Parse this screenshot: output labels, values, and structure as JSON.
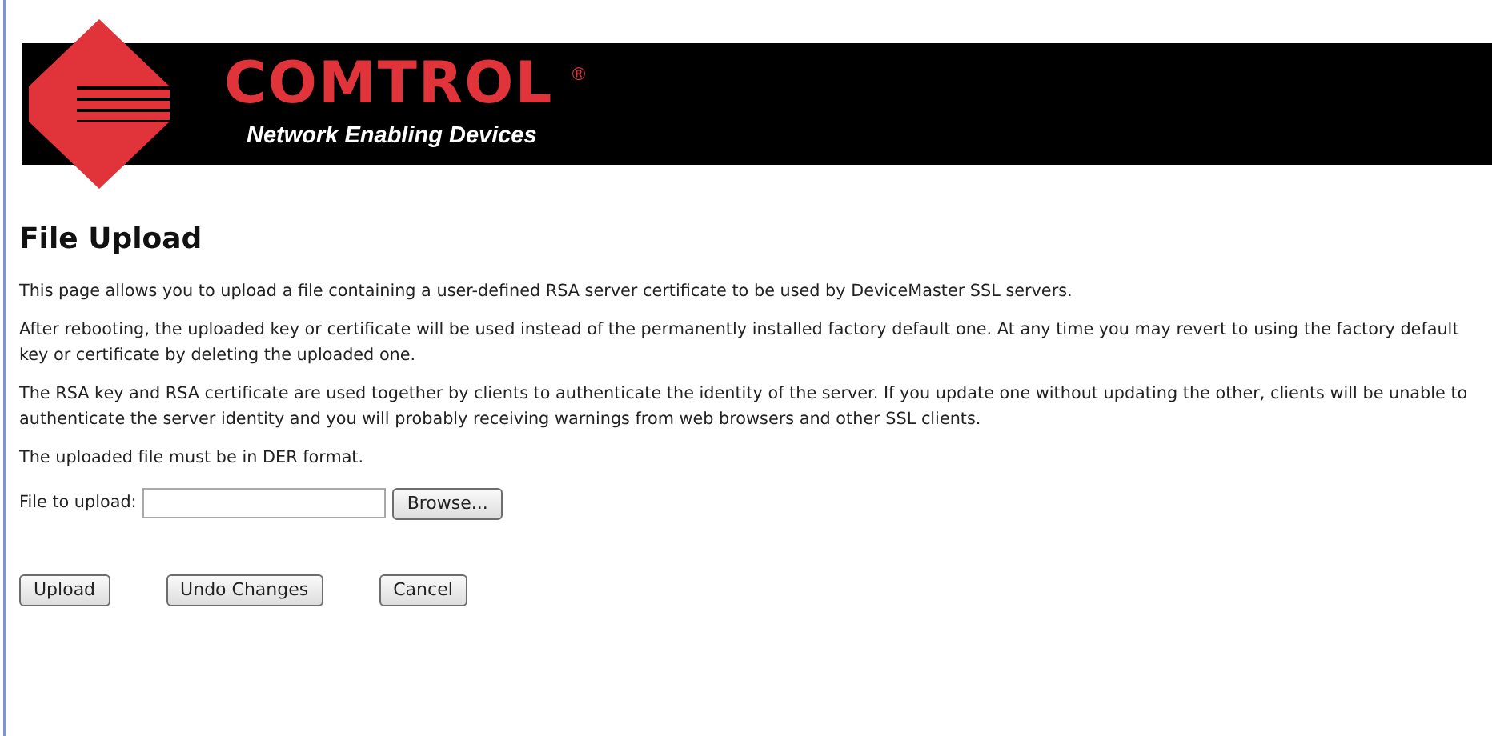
{
  "logo": {
    "brand": "COMTROL",
    "registered": "®",
    "tagline": "Network Enabling Devices"
  },
  "page_title": "File Upload",
  "paragraphs": [
    "This page allows you to upload a file containing a user-defined RSA server certificate to be used by DeviceMaster SSL servers.",
    "After rebooting, the uploaded key or certificate will be used instead of the permanently installed factory default one. At any time you may revert to using the factory default key or certificate by deleting the uploaded one.",
    "The RSA key and RSA certificate are used together by clients to authenticate the identity of the server. If you update one without updating the other, clients will be unable to authenticate the server identity and you will probably receiving warnings from web browsers and other SSL clients.",
    "The uploaded file must be in DER format."
  ],
  "file_field": {
    "label": "File to upload:",
    "browse_button": "Browse..."
  },
  "buttons": [
    "Upload",
    "Undo Changes",
    "Cancel"
  ]
}
